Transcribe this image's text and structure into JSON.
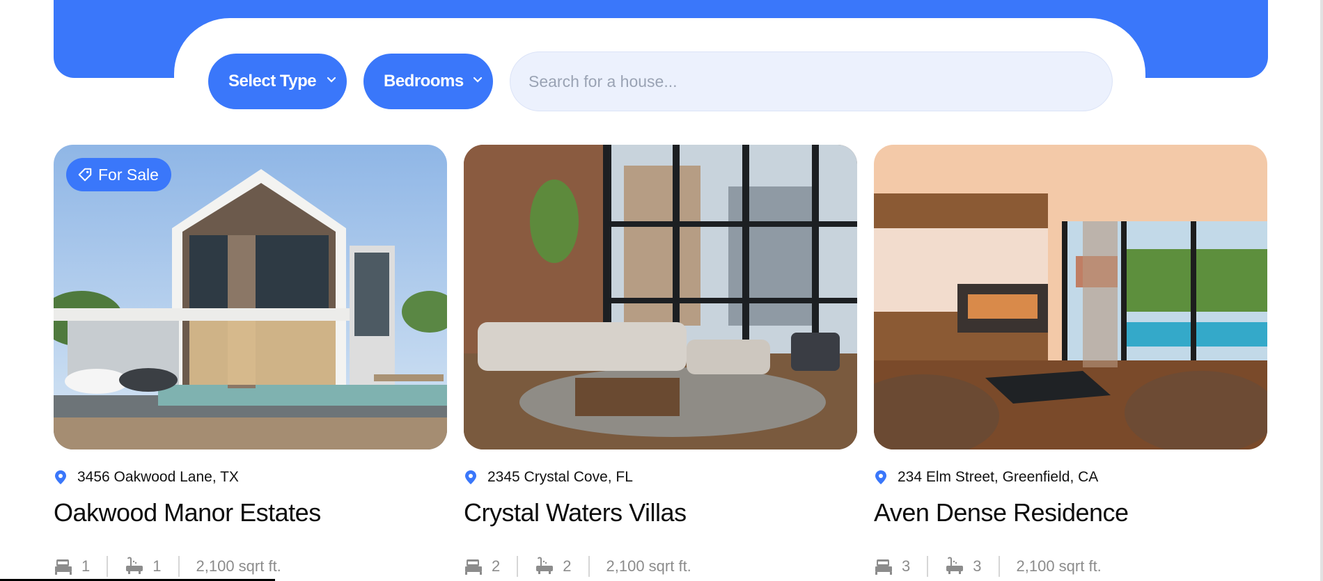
{
  "filters": {
    "type_label": "Select Type",
    "bedrooms_label": "Bedrooms",
    "search_placeholder": "Search for a house..."
  },
  "colors": {
    "accent": "#3a77fa",
    "search_bg": "#ecf1fd"
  },
  "listings": [
    {
      "badge": "For Sale",
      "address": "3456 Oakwood Lane, TX",
      "title": "Oakwood Manor Estates",
      "beds": "1",
      "baths": "1",
      "area": "2,100 sqrt ft."
    },
    {
      "address": "2345 Crystal Cove, FL",
      "title": "Crystal Waters Villas",
      "beds": "2",
      "baths": "2",
      "area": "2,100 sqrt ft."
    },
    {
      "address": "234 Elm Street, Greenfield, CA",
      "title": "Aven Dense Residence",
      "beds": "3",
      "baths": "3",
      "area": "2,100 sqrt ft."
    }
  ],
  "icons": {
    "location": "map-pin-icon",
    "bed": "bed-icon",
    "bath": "bathtub-icon",
    "tag": "tag-icon",
    "chevron": "chevron-down-icon"
  }
}
